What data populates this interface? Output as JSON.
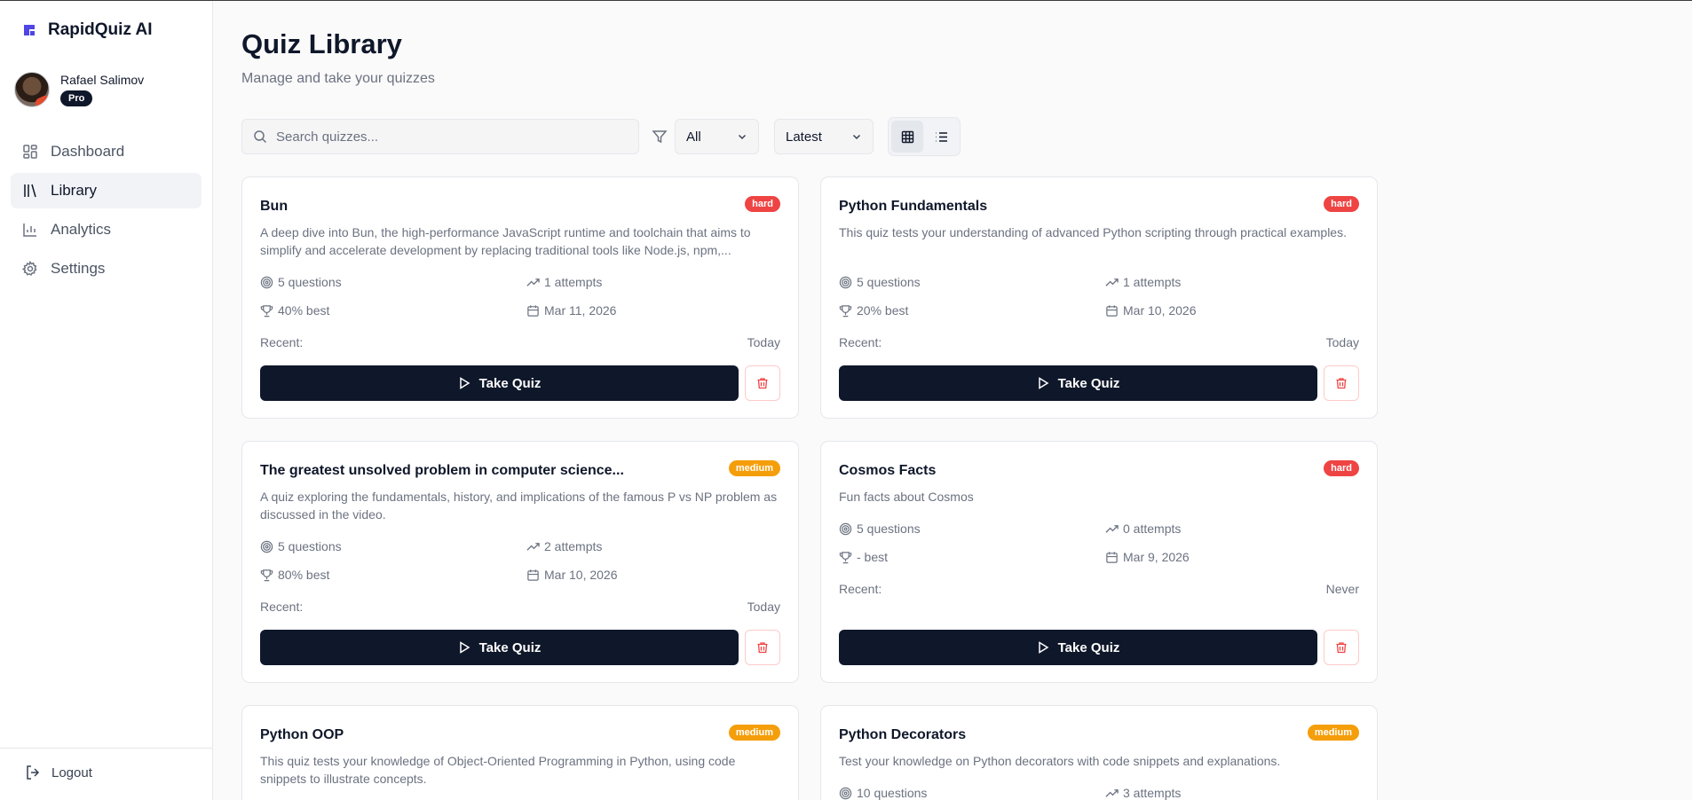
{
  "app": {
    "name": "RapidQuiz AI",
    "logo_icon": "logo-icon",
    "accent": "#4f46e5"
  },
  "user": {
    "name": "Rafael Salimov",
    "plan": "Pro"
  },
  "nav": {
    "items": [
      {
        "label": "Dashboard",
        "icon": "dashboard-icon",
        "active": false
      },
      {
        "label": "Library",
        "icon": "library-icon",
        "active": true
      },
      {
        "label": "Analytics",
        "icon": "analytics-icon",
        "active": false
      },
      {
        "label": "Settings",
        "icon": "settings-icon",
        "active": false
      }
    ],
    "logout": "Logout"
  },
  "page": {
    "title": "Quiz Library",
    "subtitle": "Manage and take your quizzes"
  },
  "toolbar": {
    "search_placeholder": "Search quizzes...",
    "category_value": "All",
    "sort_value": "Latest",
    "view_mode": "grid"
  },
  "labels": {
    "take_quiz": "Take Quiz",
    "recent": "Recent:"
  },
  "colors": {
    "hard": "#ef4444",
    "medium": "#f59e0b",
    "primary_button": "#0f172a"
  },
  "quizzes": [
    {
      "title": "Bun",
      "difficulty": "hard",
      "description": "A deep dive into Bun, the high-performance JavaScript runtime and toolchain that aims to simplify and accelerate development by replacing traditional tools like Node.js, npm,...",
      "questions": "5 questions",
      "attempts": "1 attempts",
      "best": "40% best",
      "date": "Mar 11, 2026",
      "recent": "Today"
    },
    {
      "title": "Python Fundamentals",
      "difficulty": "hard",
      "description": "This quiz tests your understanding of advanced Python scripting through practical examples.",
      "questions": "5 questions",
      "attempts": "1 attempts",
      "best": "20% best",
      "date": "Mar 10, 2026",
      "recent": "Today"
    },
    {
      "title": "The greatest unsolved problem in computer science...",
      "difficulty": "medium",
      "description": "A quiz exploring the fundamentals, history, and implications of the famous P vs NP problem as discussed in the video.",
      "questions": "5 questions",
      "attempts": "2 attempts",
      "best": "80% best",
      "date": "Mar 10, 2026",
      "recent": "Today"
    },
    {
      "title": "Cosmos Facts",
      "difficulty": "hard",
      "description": "Fun facts about Cosmos",
      "questions": "5 questions",
      "attempts": "0 attempts",
      "best": "- best",
      "date": "Mar 9, 2026",
      "recent": "Never"
    },
    {
      "title": "Python OOP",
      "difficulty": "medium",
      "description": "This quiz tests your knowledge of Object-Oriented Programming in Python, using code snippets to illustrate concepts.",
      "questions": "",
      "attempts": "",
      "best": "",
      "date": "",
      "recent": ""
    },
    {
      "title": "Python Decorators",
      "difficulty": "medium",
      "description": "Test your knowledge on Python decorators with code snippets and explanations.",
      "questions": "10 questions",
      "attempts": "3 attempts",
      "best": "",
      "date": "",
      "recent": ""
    }
  ]
}
